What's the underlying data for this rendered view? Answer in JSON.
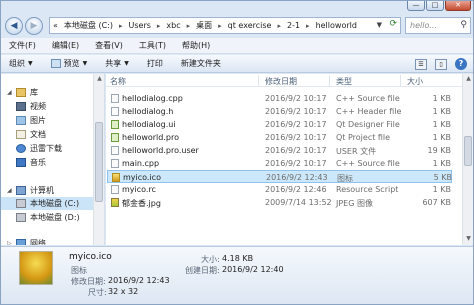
{
  "window": {
    "min_glyph": "—",
    "max_glyph": "□",
    "close_glyph": "✕"
  },
  "address": {
    "crumbs": [
      "«",
      "本地磁盘 (C:)",
      "Users",
      "xbc",
      "桌面",
      "qt exercise",
      "2-1",
      "helloworld"
    ],
    "separator": "▸",
    "search_placeholder": "hello..."
  },
  "menu": [
    "文件(F)",
    "编辑(E)",
    "查看(V)",
    "工具(T)",
    "帮助(H)"
  ],
  "commands": [
    "组织",
    "预览",
    "共享",
    "打印",
    "新建文件夹"
  ],
  "nav": {
    "items": [
      "库",
      "视频",
      "图片",
      "文档",
      "迅雷下载",
      "音乐",
      "计算机",
      "本地磁盘 (C:)",
      "本地磁盘 (D:)",
      "网络"
    ]
  },
  "columns": {
    "name": "名称",
    "date": "修改日期",
    "type": "类型",
    "size": "大小"
  },
  "files": [
    {
      "name": "hellodialog.cpp",
      "date": "2016/9/2 10:17",
      "type": "C++ Source file",
      "size": "1 KB"
    },
    {
      "name": "hellodialog.h",
      "date": "2016/9/2 10:17",
      "type": "C++ Header file",
      "size": "1 KB"
    },
    {
      "name": "hellodialog.ui",
      "date": "2016/9/2 10:17",
      "type": "Qt Designer File",
      "size": "1 KB"
    },
    {
      "name": "helloworld.pro",
      "date": "2016/9/2 10:17",
      "type": "Qt Project file",
      "size": "1 KB"
    },
    {
      "name": "helloworld.pro.user",
      "date": "2016/9/2 10:17",
      "type": "USER 文件",
      "size": "19 KB"
    },
    {
      "name": "main.cpp",
      "date": "2016/9/2 10:17",
      "type": "C++ Source file",
      "size": "1 KB"
    },
    {
      "name": "myico.ico",
      "date": "2016/9/2 12:43",
      "type": "图标",
      "size": "5 KB"
    },
    {
      "name": "myico.rc",
      "date": "2016/9/2 12:46",
      "type": "Resource Script",
      "size": "1 KB"
    },
    {
      "name": "郁金香.jpg",
      "date": "2009/7/14 13:52",
      "type": "JPEG 图像",
      "size": "607 KB"
    }
  ],
  "selected_index": 6,
  "details": {
    "name": "myico.ico",
    "type": "图标",
    "modified_label": "修改日期:",
    "modified": "2016/9/2 12:43",
    "dimensions_label": "尺寸:",
    "dimensions": "32 x 32",
    "size_label": "大小:",
    "size": "4.18 KB",
    "created_label": "创建日期:",
    "created": "2016/9/2 12:40"
  }
}
